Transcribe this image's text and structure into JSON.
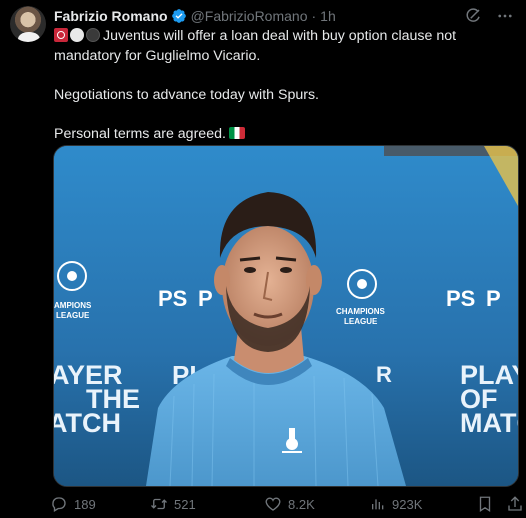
{
  "post": {
    "author_name": "Fabrizio Romano",
    "handle": "@FabrizioRomano",
    "separator": "·",
    "time": "1h",
    "text_line1": "Juventus will offer a loan deal with buy option clause not mandatory for Guglielmo Vicario.",
    "text_line2": "Negotiations to advance today with Spurs.",
    "text_line3": "Personal terms are agreed.",
    "media_text": {
      "champions_league_left": "CHAMPIONS\nLEAGUE",
      "champions_league_mid": "CHAMPIONS\nLEAGUE",
      "ps_left": "P",
      "ps_right": "P",
      "player_left_1": "AYER",
      "player_left_2": "THE",
      "player_left_3": "ATCH",
      "player_right_1": "PLAY",
      "player_right_2": "OF",
      "player_right_3": "MATC",
      "player_mid": "PL"
    }
  },
  "actions": {
    "replies": "189",
    "reposts": "521",
    "likes": "8.2K",
    "views": "923K"
  },
  "colors": {
    "background": "#000000",
    "text": "#e7e9ea",
    "muted": "#71767b",
    "verified": "#1d9bf0",
    "shirt": "#5aa8de"
  },
  "icons": [
    "verified-badge-icon",
    "grok-icon",
    "more-icon",
    "reply-icon",
    "repost-icon",
    "like-icon",
    "views-icon",
    "bookmark-icon",
    "share-icon"
  ]
}
